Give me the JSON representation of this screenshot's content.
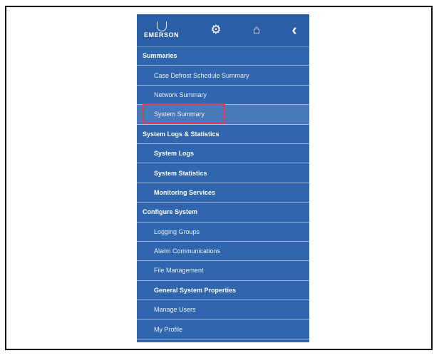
{
  "brand": {
    "logo_text": "EMERSON"
  },
  "menu": [
    {
      "label": "Summaries",
      "type": "section"
    },
    {
      "label": "Case Defrost Schedule Summary",
      "type": "item"
    },
    {
      "label": "Network Summary",
      "type": "item"
    },
    {
      "label": "System Summary",
      "type": "item",
      "active": true
    },
    {
      "label": "System Logs & Statistics",
      "type": "section"
    },
    {
      "label": "System Logs",
      "type": "item",
      "bold": true
    },
    {
      "label": "System Statistics",
      "type": "item",
      "bold": true
    },
    {
      "label": "Monitoring Services",
      "type": "item",
      "bold": true
    },
    {
      "label": "Configure System",
      "type": "section"
    },
    {
      "label": "Logging Groups",
      "type": "item"
    },
    {
      "label": "Alarm Communications",
      "type": "item"
    },
    {
      "label": "File Management",
      "type": "item"
    },
    {
      "label": "General System Properties",
      "type": "item",
      "bold": true
    },
    {
      "label": "Manage Users",
      "type": "item"
    },
    {
      "label": "My Profile",
      "type": "item"
    }
  ],
  "colors": {
    "panel": "#2f66ad",
    "active_row": "#4a79bb",
    "highlight": "#e23a4f"
  }
}
